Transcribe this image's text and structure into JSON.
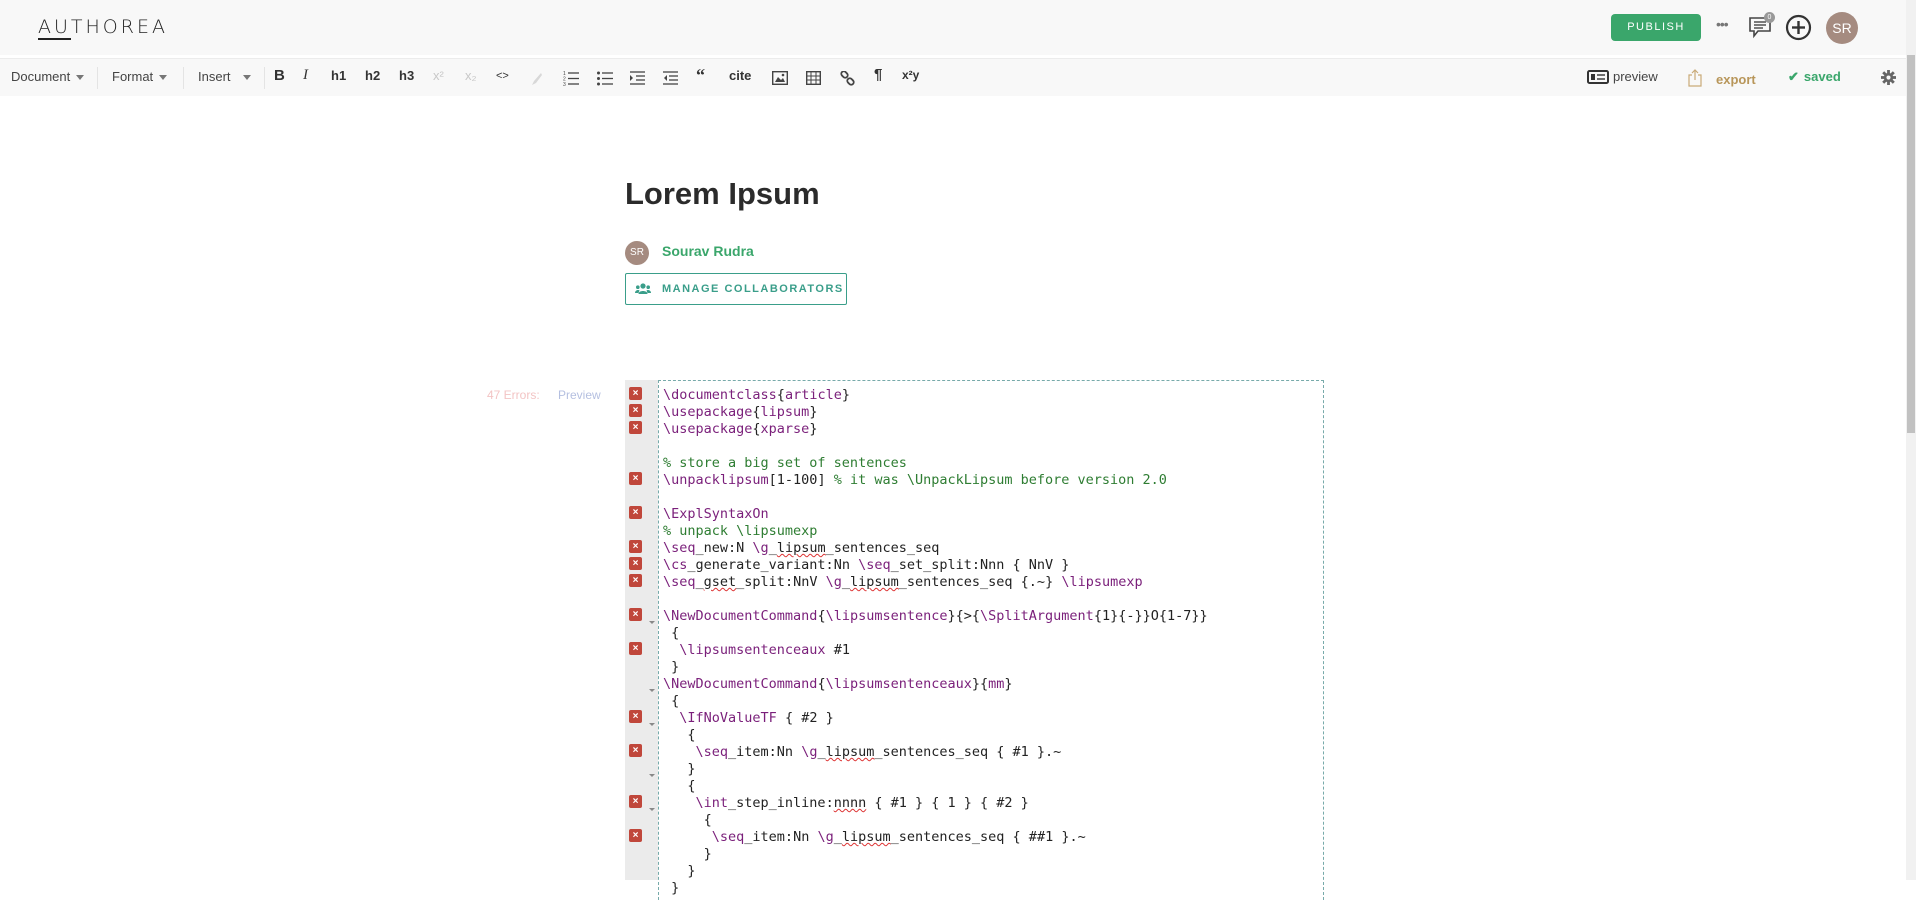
{
  "app": {
    "logo": "AUTHOREA",
    "publish_label": "PUBLISH",
    "more_label": "•••",
    "comments_count": "0",
    "user_initials": "SR"
  },
  "toolbar": {
    "menus": [
      "Document",
      "Format",
      "Insert"
    ],
    "bold": "B",
    "italic": "I",
    "h1": "h1",
    "h2": "h2",
    "h3": "h3",
    "superscript": "x²",
    "subscript": "x₂",
    "code": "<>",
    "cite": "cite",
    "pilcrow": "¶",
    "xy": "x²y",
    "preview": "preview",
    "export": "export",
    "saved": "saved"
  },
  "document": {
    "title": "Lorem Ipsum",
    "author_initials": "SR",
    "author_name": "Sourav Rudra",
    "manage_collaborators": "MANAGE COLLABORATORS"
  },
  "editor": {
    "errors_label": "47 Errors:",
    "preview_label": "Preview",
    "lines": [
      {
        "html": "<span class='kw'>\\documentclass</span>{<span class='kw'>article</span>}",
        "err": true,
        "fold": false
      },
      {
        "html": "<span class='kw'>\\usepackage</span>{<span class='kw'>lipsum</span>}",
        "err": true,
        "fold": false
      },
      {
        "html": "<span class='kw'>\\usepackage</span>{<span class='kw'>xparse</span>}",
        "err": true,
        "fold": false
      },
      {
        "html": "",
        "err": false,
        "fold": false
      },
      {
        "html": "<span class='cm'>% store a big set of sentences</span>",
        "err": false,
        "fold": false
      },
      {
        "html": "<span class='kw'>\\unpacklipsum</span>[1-100] <span class='cm'>% it was \\UnpackLipsum before version 2.0</span>",
        "err": true,
        "fold": false
      },
      {
        "html": "",
        "err": false,
        "fold": false
      },
      {
        "html": "<span class='kw'>\\ExplSyntaxOn</span>",
        "err": true,
        "fold": false
      },
      {
        "html": "<span class='cm'>% unpack \\lipsumexp</span>",
        "err": false,
        "fold": false
      },
      {
        "html": "<span class='kw'>\\seq</span>_new:N <span class='kw'>\\g</span>_<span class='sq'>lipsum</span>_sentences_seq",
        "err": true,
        "fold": false
      },
      {
        "html": "<span class='kw'>\\cs</span>_generate_variant:Nn <span class='kw'>\\seq</span>_set_split:Nnn { NnV }",
        "err": true,
        "fold": false
      },
      {
        "html": "<span class='kw'>\\seq</span>_<span class='sq'>gset</span>_split:NnV <span class='kw'>\\g</span>_<span class='sq'>lipsum</span>_sentences_seq {.~} <span class='kw'>\\lipsumexp</span>",
        "err": true,
        "fold": false
      },
      {
        "html": "",
        "err": false,
        "fold": false
      },
      {
        "html": "<span class='kw'>\\NewDocumentCommand</span>{<span class='kw'>\\lipsumsentence</span>}{&gt;{<span class='kw'>\\SplitArgument</span>{1}{-}}O{1-7}}",
        "err": true,
        "fold": false
      },
      {
        "html": " {",
        "err": false,
        "fold": true
      },
      {
        "html": "  <span class='kw'>\\lipsumsentenceaux</span> #1",
        "err": true,
        "fold": false
      },
      {
        "html": " }",
        "err": false,
        "fold": false
      },
      {
        "html": "<span class='kw'>\\NewDocumentCommand</span>{<span class='kw'>\\lipsumsentenceaux</span>}{<span class='kw'>mm</span>}",
        "err": false,
        "fold": false
      },
      {
        "html": " {",
        "err": false,
        "fold": true
      },
      {
        "html": "  <span class='kw'>\\IfNoValueTF</span> { #2 }",
        "err": true,
        "fold": false
      },
      {
        "html": "   {",
        "err": false,
        "fold": true
      },
      {
        "html": "    <span class='kw'>\\seq</span>_item:Nn <span class='kw'>\\g</span>_<span class='sq'>lipsum</span>_sentences_seq { #1 }.~",
        "err": true,
        "fold": false
      },
      {
        "html": "   }",
        "err": false,
        "fold": false
      },
      {
        "html": "   {",
        "err": false,
        "fold": true
      },
      {
        "html": "    <span class='kw'>\\int</span>_step_inline:<span class='sq'>nnnn</span> { #1 } { 1 } { #2 }",
        "err": true,
        "fold": false
      },
      {
        "html": "     {",
        "err": false,
        "fold": true
      },
      {
        "html": "      <span class='kw'>\\seq</span>_item:Nn <span class='kw'>\\g</span>_<span class='sq'>lipsum</span>_sentences_seq { ##1 }.~",
        "err": true,
        "fold": false
      },
      {
        "html": "     }",
        "err": false,
        "fold": false
      },
      {
        "html": "   }",
        "err": false,
        "fold": false
      },
      {
        "html": " }",
        "err": false,
        "fold": false
      }
    ]
  }
}
